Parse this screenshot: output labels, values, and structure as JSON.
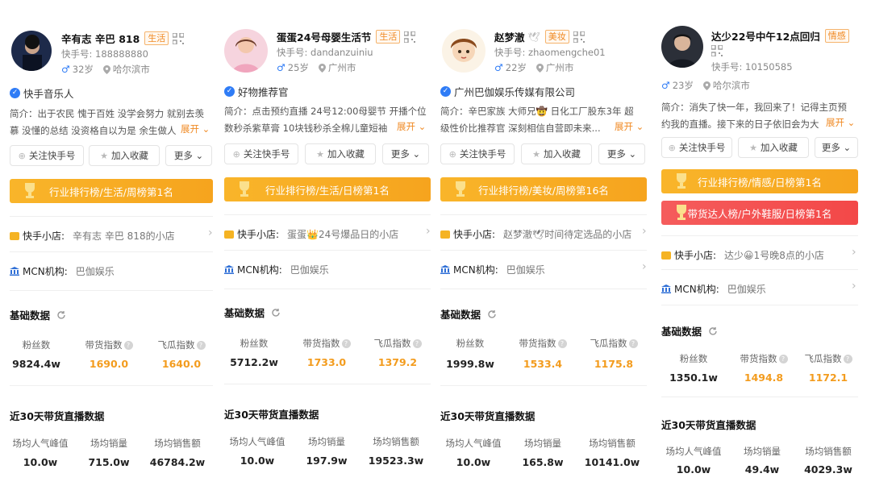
{
  "ui": {
    "intro_prefix": "简介：",
    "expand_label": "展开",
    "follow_label": "关注快手号",
    "collect_label": "加入收藏",
    "more_label": "更多",
    "shop_label": "快手小店:",
    "mcn_label": "MCN机构:",
    "basic_data_title": "基础数据",
    "live_data_title": "近30天带货直播数据",
    "fans_label": "粉丝数",
    "goods_index_label": "带货指数",
    "feigua_index_label": "飞瓜指数",
    "avg_viewers_label": "场均人气峰值",
    "avg_sales_label": "场均销量",
    "avg_revenue_label": "场均销售额"
  },
  "colors": {
    "accent": "#f39c1e",
    "rank_orange": "#f7a922",
    "rank_red": "#f34848",
    "verify_blue": "#2f7cf6"
  },
  "cards": [
    {
      "name": "辛有志 辛巴 818",
      "tag": "生活",
      "kuaishou_id": "快手号: 188888880",
      "age": "32岁",
      "city": "哈尔滨市",
      "verification": "快手音乐人",
      "intro_line1": "简介：出于农民 愧于百姓 没学会努力 就别去羡",
      "intro_line2": "慕 没懂的总结 没资格自以为是 余生做人",
      "ranks": [
        {
          "text": "行业排行榜/生活/周榜第1名",
          "style": "orange"
        }
      ],
      "shop": "辛有志 辛巴 818的小店",
      "mcn": "巴伽娱乐",
      "fans": "9824.4w",
      "goods_index": "1690.0",
      "feigua_index": "1640.0",
      "avg_viewers": "10.0w",
      "avg_sales": "715.0w",
      "avg_revenue": "46784.2w"
    },
    {
      "name": "蛋蛋24号母婴生活节",
      "tag": "生活",
      "kuaishou_id": "快手号: dandanzuiniu",
      "age": "25岁",
      "city": "广州市",
      "verification": "好物推荐官",
      "intro_line1": "简介：点击预约直播 24号12:00母婴节 开播个位",
      "intro_line2": "数秒杀紫草膏 10块钱秒杀全棉儿童短袖",
      "ranks": [
        {
          "text": "行业排行榜/生活/日榜第1名",
          "style": "orange"
        }
      ],
      "shop": "蛋蛋👑24号爆品日的小店",
      "mcn": "巴伽娱乐",
      "fans": "5712.2w",
      "goods_index": "1733.0",
      "feigua_index": "1379.2",
      "avg_viewers": "10.0w",
      "avg_sales": "197.9w",
      "avg_revenue": "19523.3w"
    },
    {
      "name": "赵梦澈",
      "tag": "美妆",
      "kuaishou_id": "快手号: zhaomengche01",
      "age": "22岁",
      "city": "广州市",
      "verification": "广州巴伽娱乐传媒有限公司",
      "intro_line1": "简介：辛巴家族 大师兄🤠 日化工厂股东3年 超",
      "intro_line2": "级性价比推荐官 深刻相信自营即未来...",
      "ranks": [
        {
          "text": "行业排行榜/美妆/周榜第16名",
          "style": "orange"
        }
      ],
      "shop": "赵梦澈🕊时间待定选品的小店",
      "mcn": "巴伽娱乐",
      "fans": "1999.8w",
      "goods_index": "1533.4",
      "feigua_index": "1175.8",
      "avg_viewers": "10.0w",
      "avg_sales": "165.8w",
      "avg_revenue": "10141.0w"
    },
    {
      "name": "达少22号中午12点回归",
      "tag": "情感",
      "kuaishou_id": "快手号: 10150585",
      "age": "23岁",
      "city": "哈尔滨市",
      "verification": "",
      "intro_line1": "简介：消失了快一年，我回来了！记得主页预",
      "intro_line2": "约我的直播。接下来的日子依旧会为大",
      "ranks": [
        {
          "text": "行业排行榜/情感/日榜第1名",
          "style": "orange"
        },
        {
          "text": "带货达人榜/户外鞋服/日榜第1名",
          "style": "red"
        }
      ],
      "shop": "达少😀1号晚8点的小店",
      "mcn": "巴伽娱乐",
      "fans": "1350.1w",
      "goods_index": "1494.8",
      "feigua_index": "1172.1",
      "avg_viewers": "10.0w",
      "avg_sales": "49.4w",
      "avg_revenue": "4029.3w"
    }
  ]
}
